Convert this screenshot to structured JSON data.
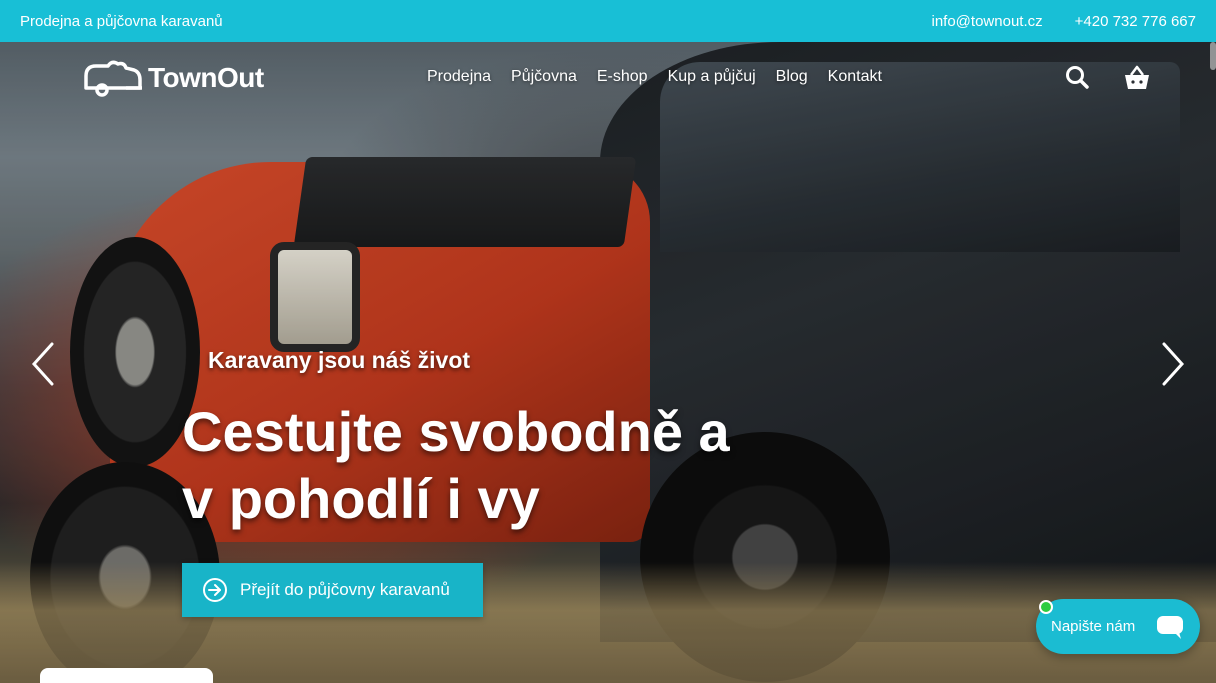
{
  "topbar": {
    "tagline": "Prodejna a půjčovna karavanů",
    "email": "info@townout.cz",
    "phone": "+420 732 776 667",
    "background": "#18bfd6"
  },
  "brand": {
    "name": "TownOut",
    "logo_icon": "caravan-cloud-icon"
  },
  "menu": [
    {
      "label": "Prodejna"
    },
    {
      "label": "Půjčovna"
    },
    {
      "label": "E-shop"
    },
    {
      "label": "Kup a půjčuj"
    },
    {
      "label": "Blog"
    },
    {
      "label": "Kontakt"
    }
  ],
  "icons": {
    "search": "search-icon",
    "cart": "basket-icon",
    "prev": "chevron-left-icon",
    "next": "chevron-right-icon",
    "cta": "arrow-circle-right-icon",
    "chat": "chat-bubble-icon"
  },
  "hero": {
    "kicker": "Karavany jsou náš život",
    "headline_line1": "Cestujte svobodně a",
    "headline_line2": "v pohodlí i vy",
    "cta_label": "Přejít do půjčovny karavanů",
    "accent": "#18b4c8"
  },
  "chat": {
    "label": "Napište nám",
    "status_color": "#2ecc40"
  }
}
